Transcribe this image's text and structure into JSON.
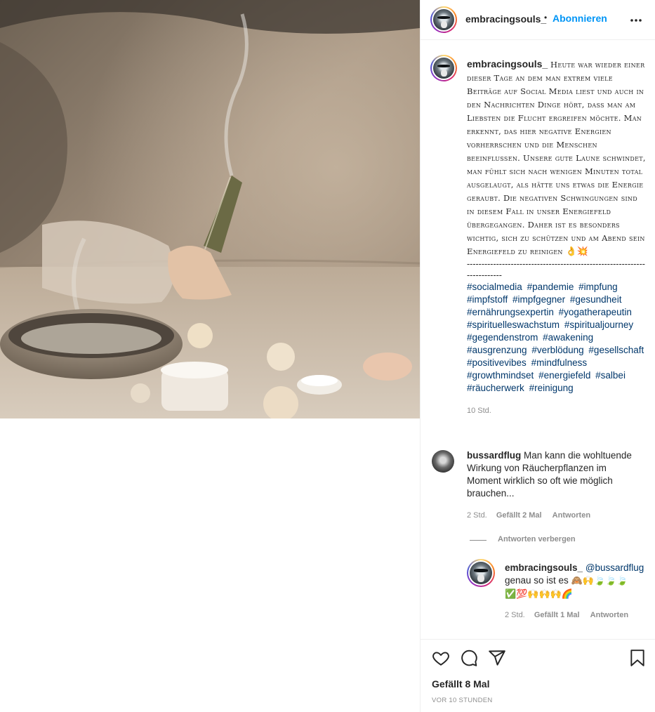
{
  "post": {
    "author": "embracingsouls_",
    "follow_label": "Abonnieren",
    "separator": "•",
    "caption": "Heute war wieder einer dieser Tage an dem man extrem viele Beiträge auf Social Media liest und auch in den Nachrichten Dinge hört, dass man am Liebsten die Flucht ergreifen möchte. Man erkennt, das hier negative Energien vorherrschen und die Menschen beeinflussen. Unsere gute Laune schwindet, man fühlt sich nach wenigen Minuten total ausgelaugt, als hätte uns etwas die Energie geraubt. Die negativen Schwingungen sind in diesem Fall in unser Energiefeld übergegangen. Daher ist es besonders wichtig, sich zu schützen und am Abend sein Energiefeld zu reinigen",
    "caption_emojis": "👌💥",
    "dashes": "-------------------------------------------------------------------------",
    "hashtags": [
      "#socialmedia",
      "#pandemie",
      "#impfung",
      "#impfstoff",
      "#impfgegner",
      "#gesundheit",
      "#ernährungsexpertin",
      "#yogatherapeutin",
      "#spirituelleswachstum",
      "#spiritualjourney",
      "#gegendenstrom",
      "#awakening",
      "#ausgrenzung",
      "#verblödung",
      "#gesellschaft",
      "#positivevibes",
      "#mindfulness",
      "#growthmindset",
      "#energiefeld",
      "#salbei",
      "#räucherwerk",
      "#reinigung"
    ],
    "caption_time": "10 Std."
  },
  "comments": [
    {
      "author": "bussardflug",
      "text": "Man kann die wohltuende Wirkung von Räucherpflanzen im Moment wirklich so oft wie möglich brauchen...",
      "time": "2 Std.",
      "likes": "Gefällt 2 Mal",
      "reply_label": "Antworten",
      "hide_replies": "Antworten verbergen",
      "replies": [
        {
          "author": "embracingsouls_",
          "mention": "@bussardflug",
          "text": "genau so ist es",
          "emojis_line1": "🙈🙌🍃🍃🍃",
          "emojis_line2": "✅💯🙌🙌🙌🌈",
          "time": "2 Std.",
          "likes": "Gefällt 1 Mal",
          "reply_label": "Antworten"
        }
      ]
    }
  ],
  "footer": {
    "likes": "Gefällt 8 Mal",
    "timestamp": "VOR 10 STUNDEN"
  },
  "icons": {
    "more": "more-options-icon",
    "like": "heart-icon",
    "comment": "comment-icon",
    "share": "paper-plane-icon",
    "save": "bookmark-icon"
  },
  "colors": {
    "link_blue": "#0095f6",
    "hashtag": "#00376b",
    "muted": "#8e8e8e",
    "text": "#262626"
  }
}
